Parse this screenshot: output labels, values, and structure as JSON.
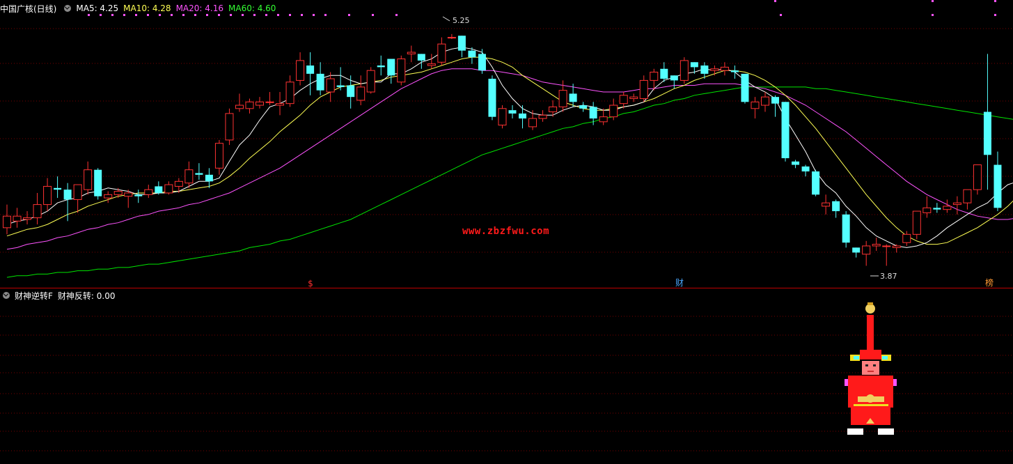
{
  "main_legend": {
    "title": "中国广核(日线)",
    "ma5": "MA5: 4.25",
    "ma10": "MA10: 4.28",
    "ma20": "MA20: 4.16",
    "ma60": "MA60: 4.60"
  },
  "sub_legend": {
    "indicator": "财神逆转F",
    "value": "财神反转: 0.00"
  },
  "watermark": "www.zbzfwu.com",
  "markers": {
    "high": "5.25",
    "low": "3.87",
    "signal_dollar": "$",
    "signal_cai": "财",
    "signal_bang": "榜"
  },
  "colors": {
    "background": "#000000",
    "up": "#ff3232",
    "down": "#54ffff",
    "ma5": "#ffffff",
    "ma10": "#ffff54",
    "ma20": "#ff54ff",
    "ma60": "#00e600",
    "grid": "#7a0000"
  },
  "chart_data": {
    "type": "candlestick",
    "title": "中国广核(日线)",
    "price_range": [
      3.75,
      5.4
    ],
    "candles": [
      {
        "o": 4.1,
        "h": 4.24,
        "l": 4.06,
        "c": 4.17
      },
      {
        "o": 4.14,
        "h": 4.22,
        "l": 4.1,
        "c": 4.17
      },
      {
        "o": 4.15,
        "h": 4.2,
        "l": 4.12,
        "c": 4.16
      },
      {
        "o": 4.16,
        "h": 4.31,
        "l": 4.12,
        "c": 4.24
      },
      {
        "o": 4.24,
        "h": 4.4,
        "l": 4.2,
        "c": 4.35
      },
      {
        "o": 4.34,
        "h": 4.41,
        "l": 4.28,
        "c": 4.33
      },
      {
        "o": 4.33,
        "h": 4.37,
        "l": 4.14,
        "c": 4.27
      },
      {
        "o": 4.27,
        "h": 4.36,
        "l": 4.19,
        "c": 4.36
      },
      {
        "o": 4.33,
        "h": 4.5,
        "l": 4.3,
        "c": 4.45
      },
      {
        "o": 4.45,
        "h": 4.46,
        "l": 4.27,
        "c": 4.29
      },
      {
        "o": 4.28,
        "h": 4.32,
        "l": 4.25,
        "c": 4.3
      },
      {
        "o": 4.3,
        "h": 4.34,
        "l": 4.28,
        "c": 4.32
      },
      {
        "o": 4.29,
        "h": 4.33,
        "l": 4.22,
        "c": 4.31
      },
      {
        "o": 4.3,
        "h": 4.33,
        "l": 4.25,
        "c": 4.29
      },
      {
        "o": 4.3,
        "h": 4.36,
        "l": 4.28,
        "c": 4.33
      },
      {
        "o": 4.35,
        "h": 4.38,
        "l": 4.3,
        "c": 4.31
      },
      {
        "o": 4.31,
        "h": 4.38,
        "l": 4.3,
        "c": 4.36
      },
      {
        "o": 4.35,
        "h": 4.4,
        "l": 4.31,
        "c": 4.38
      },
      {
        "o": 4.37,
        "h": 4.5,
        "l": 4.34,
        "c": 4.45
      },
      {
        "o": 4.43,
        "h": 4.49,
        "l": 4.39,
        "c": 4.42
      },
      {
        "o": 4.42,
        "h": 4.46,
        "l": 4.34,
        "c": 4.38
      },
      {
        "o": 4.46,
        "h": 4.63,
        "l": 4.42,
        "c": 4.61
      },
      {
        "o": 4.63,
        "h": 4.82,
        "l": 4.6,
        "c": 4.79
      },
      {
        "o": 4.82,
        "h": 4.91,
        "l": 4.8,
        "c": 4.84
      },
      {
        "o": 4.82,
        "h": 4.88,
        "l": 4.79,
        "c": 4.86
      },
      {
        "o": 4.84,
        "h": 4.89,
        "l": 4.82,
        "c": 4.86
      },
      {
        "o": 4.86,
        "h": 4.92,
        "l": 4.84,
        "c": 4.86
      },
      {
        "o": 4.84,
        "h": 4.92,
        "l": 4.78,
        "c": 4.85
      },
      {
        "o": 4.85,
        "h": 5.02,
        "l": 4.83,
        "c": 4.98
      },
      {
        "o": 4.99,
        "h": 5.16,
        "l": 4.96,
        "c": 5.11
      },
      {
        "o": 5.08,
        "h": 5.16,
        "l": 4.9,
        "c": 5.03
      },
      {
        "o": 5.03,
        "h": 5.1,
        "l": 4.9,
        "c": 4.93
      },
      {
        "o": 4.92,
        "h": 5.04,
        "l": 4.86,
        "c": 5.0
      },
      {
        "o": 4.96,
        "h": 5.07,
        "l": 4.93,
        "c": 4.95
      },
      {
        "o": 4.96,
        "h": 5.02,
        "l": 4.82,
        "c": 4.89
      },
      {
        "o": 4.87,
        "h": 5.02,
        "l": 4.84,
        "c": 4.95
      },
      {
        "o": 4.92,
        "h": 5.07,
        "l": 4.91,
        "c": 5.05
      },
      {
        "o": 5.08,
        "h": 5.14,
        "l": 5.02,
        "c": 5.07
      },
      {
        "o": 5.12,
        "h": 5.07,
        "l": 4.97,
        "c": 5.02
      },
      {
        "o": 4.98,
        "h": 5.14,
        "l": 4.96,
        "c": 5.12
      },
      {
        "o": 5.15,
        "h": 5.2,
        "l": 5.1,
        "c": 5.16
      },
      {
        "o": 5.15,
        "h": 5.14,
        "l": 5.06,
        "c": 5.11
      },
      {
        "o": 5.08,
        "h": 5.15,
        "l": 5.06,
        "c": 5.09
      },
      {
        "o": 5.1,
        "h": 5.25,
        "l": 5.08,
        "c": 5.21
      },
      {
        "o": 5.25,
        "h": 5.27,
        "l": 5.24,
        "c": 5.25
      },
      {
        "o": 5.26,
        "h": 5.26,
        "l": 5.13,
        "c": 5.17
      },
      {
        "o": 5.17,
        "h": 5.19,
        "l": 5.09,
        "c": 5.13
      },
      {
        "o": 5.15,
        "h": 5.18,
        "l": 5.03,
        "c": 5.05
      },
      {
        "o": 5.0,
        "h": 5.02,
        "l": 4.75,
        "c": 4.77
      },
      {
        "o": 4.72,
        "h": 4.84,
        "l": 4.7,
        "c": 4.82
      },
      {
        "o": 4.81,
        "h": 4.84,
        "l": 4.76,
        "c": 4.79
      },
      {
        "o": 4.79,
        "h": 4.84,
        "l": 4.7,
        "c": 4.76
      },
      {
        "o": 4.71,
        "h": 4.81,
        "l": 4.69,
        "c": 4.76
      },
      {
        "o": 4.76,
        "h": 4.81,
        "l": 4.74,
        "c": 4.78
      },
      {
        "o": 4.8,
        "h": 4.87,
        "l": 4.77,
        "c": 4.83
      },
      {
        "o": 4.83,
        "h": 4.99,
        "l": 4.8,
        "c": 4.93
      },
      {
        "o": 4.91,
        "h": 4.97,
        "l": 4.83,
        "c": 4.86
      },
      {
        "o": 4.84,
        "h": 4.86,
        "l": 4.8,
        "c": 4.82
      },
      {
        "o": 4.83,
        "h": 4.86,
        "l": 4.72,
        "c": 4.76
      },
      {
        "o": 4.74,
        "h": 4.82,
        "l": 4.72,
        "c": 4.77
      },
      {
        "o": 4.77,
        "h": 4.88,
        "l": 4.75,
        "c": 4.84
      },
      {
        "o": 4.85,
        "h": 4.92,
        "l": 4.82,
        "c": 4.9
      },
      {
        "o": 4.88,
        "h": 4.91,
        "l": 4.86,
        "c": 4.89
      },
      {
        "o": 4.88,
        "h": 5.02,
        "l": 4.86,
        "c": 4.99
      },
      {
        "o": 4.99,
        "h": 5.06,
        "l": 4.93,
        "c": 5.04
      },
      {
        "o": 5.06,
        "h": 5.1,
        "l": 4.98,
        "c": 5.0
      },
      {
        "o": 5.02,
        "h": 5.02,
        "l": 4.94,
        "c": 4.99
      },
      {
        "o": 4.99,
        "h": 5.13,
        "l": 4.97,
        "c": 5.11
      },
      {
        "o": 5.1,
        "h": 5.1,
        "l": 5.03,
        "c": 5.07
      },
      {
        "o": 5.08,
        "h": 5.1,
        "l": 5.0,
        "c": 5.03
      },
      {
        "o": 5.05,
        "h": 5.08,
        "l": 5.02,
        "c": 5.06
      },
      {
        "o": 5.05,
        "h": 5.1,
        "l": 5.02,
        "c": 5.07
      },
      {
        "o": 5.05,
        "h": 5.08,
        "l": 5.0,
        "c": 5.04
      },
      {
        "o": 5.03,
        "h": 5.02,
        "l": 4.85,
        "c": 4.86
      },
      {
        "o": 4.82,
        "h": 4.89,
        "l": 4.76,
        "c": 4.86
      },
      {
        "o": 4.84,
        "h": 4.92,
        "l": 4.8,
        "c": 4.89
      },
      {
        "o": 4.89,
        "h": 4.9,
        "l": 4.77,
        "c": 4.85
      },
      {
        "o": 4.86,
        "h": 4.68,
        "l": 4.5,
        "c": 4.52
      },
      {
        "o": 4.5,
        "h": 4.51,
        "l": 4.46,
        "c": 4.48
      },
      {
        "o": 4.47,
        "h": 4.48,
        "l": 4.41,
        "c": 4.44
      },
      {
        "o": 4.44,
        "h": 4.45,
        "l": 4.29,
        "c": 4.3
      },
      {
        "o": 4.23,
        "h": 4.3,
        "l": 4.18,
        "c": 4.25
      },
      {
        "o": 4.26,
        "h": 4.27,
        "l": 4.16,
        "c": 4.2
      },
      {
        "o": 4.18,
        "h": 4.2,
        "l": 3.98,
        "c": 4.01
      },
      {
        "o": 3.98,
        "h": 3.98,
        "l": 3.92,
        "c": 3.95
      },
      {
        "o": 3.94,
        "h": 4.02,
        "l": 3.87,
        "c": 3.99
      },
      {
        "o": 3.99,
        "h": 4.04,
        "l": 3.96,
        "c": 4.0
      },
      {
        "o": 3.99,
        "h": 4.0,
        "l": 3.87,
        "c": 3.99
      },
      {
        "o": 3.98,
        "h": 4.0,
        "l": 3.95,
        "c": 3.99
      },
      {
        "o": 4.01,
        "h": 4.08,
        "l": 3.99,
        "c": 4.06
      },
      {
        "o": 4.06,
        "h": 4.2,
        "l": 4.03,
        "c": 4.2
      },
      {
        "o": 4.19,
        "h": 4.29,
        "l": 4.16,
        "c": 4.22
      },
      {
        "o": 4.22,
        "h": 4.25,
        "l": 4.19,
        "c": 4.21
      },
      {
        "o": 4.21,
        "h": 4.27,
        "l": 4.19,
        "c": 4.23
      },
      {
        "o": 4.24,
        "h": 4.29,
        "l": 4.18,
        "c": 4.25
      },
      {
        "o": 4.25,
        "h": 4.33,
        "l": 4.21,
        "c": 4.33
      },
      {
        "o": 4.33,
        "h": 4.47,
        "l": 4.3,
        "c": 4.48
      },
      {
        "o": 4.8,
        "h": 5.15,
        "l": 4.33,
        "c": 4.54
      },
      {
        "o": 4.48,
        "h": 4.56,
        "l": 4.2,
        "c": 4.22
      }
    ],
    "ma5": [
      4.12,
      4.14,
      4.15,
      4.17,
      4.2,
      4.25,
      4.27,
      4.28,
      4.31,
      4.32,
      4.34,
      4.33,
      4.32,
      4.3,
      4.3,
      4.31,
      4.31,
      4.32,
      4.35,
      4.38,
      4.38,
      4.4,
      4.5,
      4.6,
      4.66,
      4.75,
      4.83,
      4.85,
      4.88,
      4.93,
      4.97,
      5.0,
      5.02,
      5.02,
      4.99,
      4.97,
      4.98,
      4.98,
      5.03,
      5.03,
      5.06,
      5.1,
      5.12,
      5.16,
      5.18,
      5.19,
      5.18,
      5.16,
      5.07,
      4.96,
      4.88,
      4.82,
      4.79,
      4.78,
      4.78,
      4.81,
      4.83,
      4.84,
      4.83,
      4.81,
      4.81,
      4.83,
      4.84,
      4.86,
      4.94,
      4.99,
      5.01,
      5.03,
      5.04,
      5.06,
      5.05,
      5.06,
      5.04,
      4.99,
      4.95,
      4.92,
      4.88,
      4.76,
      4.66,
      4.56,
      4.44,
      4.36,
      4.31,
      4.23,
      4.17,
      4.1,
      4.05,
      4.02,
      3.99,
      3.98,
      3.99,
      4.01,
      4.05,
      4.1,
      4.14,
      4.18,
      4.22,
      4.25,
      4.31,
      4.36,
      4.38
    ],
    "ma10": [
      4.05,
      4.07,
      4.09,
      4.1,
      4.12,
      4.15,
      4.18,
      4.2,
      4.23,
      4.25,
      4.27,
      4.29,
      4.3,
      4.31,
      4.31,
      4.31,
      4.32,
      4.32,
      4.33,
      4.34,
      4.35,
      4.37,
      4.41,
      4.46,
      4.52,
      4.57,
      4.62,
      4.68,
      4.73,
      4.78,
      4.84,
      4.89,
      4.92,
      4.95,
      4.96,
      4.97,
      4.98,
      4.99,
      5.01,
      5.02,
      5.03,
      5.04,
      5.06,
      5.08,
      5.1,
      5.12,
      5.13,
      5.13,
      5.12,
      5.1,
      5.07,
      5.02,
      4.98,
      4.94,
      4.9,
      4.86,
      4.84,
      4.82,
      4.81,
      4.81,
      4.82,
      4.83,
      4.84,
      4.86,
      4.88,
      4.91,
      4.94,
      4.96,
      4.99,
      5.01,
      5.03,
      5.05,
      5.05,
      5.04,
      5.02,
      4.99,
      4.95,
      4.9,
      4.84,
      4.77,
      4.7,
      4.62,
      4.54,
      4.46,
      4.38,
      4.3,
      4.23,
      4.16,
      4.1,
      4.05,
      4.02,
      4.0,
      4.0,
      4.01,
      4.04,
      4.07,
      4.1,
      4.14,
      4.18,
      4.23,
      4.29
    ],
    "ma20": [
      3.97,
      3.98,
      4.0,
      4.01,
      4.02,
      4.04,
      4.05,
      4.07,
      4.09,
      4.1,
      4.12,
      4.13,
      4.15,
      4.17,
      4.18,
      4.2,
      4.21,
      4.22,
      4.24,
      4.25,
      4.27,
      4.29,
      4.31,
      4.34,
      4.37,
      4.4,
      4.43,
      4.46,
      4.5,
      4.54,
      4.58,
      4.62,
      4.66,
      4.7,
      4.74,
      4.78,
      4.82,
      4.86,
      4.9,
      4.94,
      4.97,
      5.0,
      5.03,
      5.05,
      5.06,
      5.06,
      5.06,
      5.05,
      5.05,
      5.04,
      5.03,
      5.02,
      5.0,
      4.98,
      4.97,
      4.96,
      4.95,
      4.94,
      4.93,
      4.92,
      4.92,
      4.92,
      4.93,
      4.94,
      4.94,
      4.95,
      4.96,
      4.96,
      4.96,
      4.97,
      4.97,
      4.97,
      4.97,
      4.96,
      4.95,
      4.94,
      4.92,
      4.9,
      4.87,
      4.84,
      4.8,
      4.76,
      4.72,
      4.68,
      4.63,
      4.58,
      4.53,
      4.48,
      4.43,
      4.38,
      4.34,
      4.3,
      4.27,
      4.24,
      4.21,
      4.19,
      4.17,
      4.16,
      4.15,
      4.15,
      4.16
    ],
    "ma60": [
      3.8,
      3.81,
      3.81,
      3.82,
      3.82,
      3.83,
      3.83,
      3.84,
      3.84,
      3.85,
      3.85,
      3.86,
      3.86,
      3.87,
      3.88,
      3.88,
      3.89,
      3.9,
      3.91,
      3.92,
      3.93,
      3.94,
      3.95,
      3.96,
      3.98,
      3.99,
      4.0,
      4.02,
      4.03,
      4.05,
      4.07,
      4.09,
      4.11,
      4.13,
      4.15,
      4.18,
      4.21,
      4.24,
      4.27,
      4.3,
      4.33,
      4.36,
      4.39,
      4.42,
      4.45,
      4.48,
      4.51,
      4.54,
      4.56,
      4.58,
      4.6,
      4.62,
      4.64,
      4.66,
      4.68,
      4.7,
      4.71,
      4.73,
      4.74,
      4.76,
      4.77,
      4.79,
      4.8,
      4.82,
      4.84,
      4.85,
      4.87,
      4.88,
      4.9,
      4.91,
      4.92,
      4.93,
      4.94,
      4.95,
      4.95,
      4.95,
      4.95,
      4.95,
      4.95,
      4.95,
      4.94,
      4.94,
      4.93,
      4.92,
      4.91,
      4.9,
      4.89,
      4.88,
      4.87,
      4.86,
      4.85,
      4.84,
      4.83,
      4.82,
      4.81,
      4.8,
      4.79,
      4.78,
      4.77,
      4.76,
      4.75
    ]
  }
}
